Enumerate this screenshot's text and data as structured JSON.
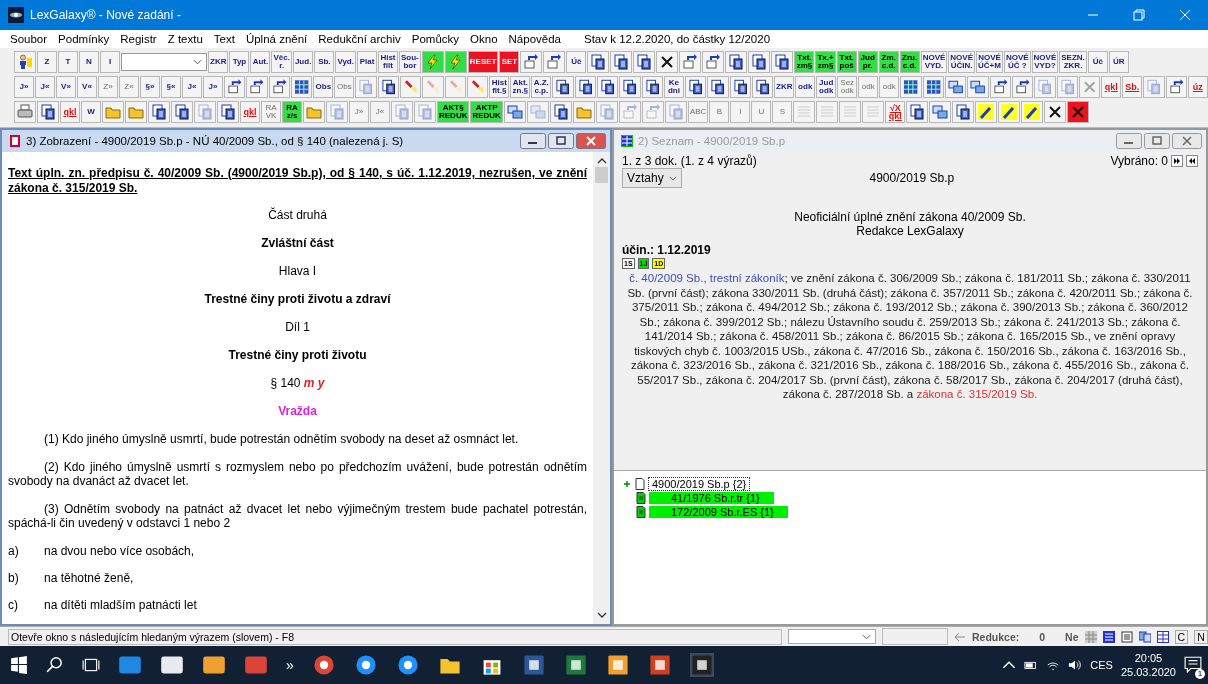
{
  "window": {
    "title": "LexGalaxy® - Nové zadání -"
  },
  "menu": {
    "items": [
      "Soubor",
      "Podmínky",
      "Registr",
      "Z textu",
      "Text",
      "Úplná znění",
      "Redukční archiv",
      "Pomůcky",
      "Okno",
      "Nápověda"
    ],
    "status": "Stav k 12.2.2020, do částky 12/2020"
  },
  "toolbar": {
    "top": [
      {
        "kind": "figure",
        "disabled": false
      },
      {
        "kind": "text",
        "label": "Z",
        "disabled": false
      },
      {
        "kind": "text",
        "label": "T",
        "disabled": false
      },
      {
        "kind": "text",
        "label": "N",
        "disabled": false
      },
      {
        "kind": "text",
        "label": "I",
        "disabled": false
      },
      {
        "kind": "combo"
      },
      {
        "kind": "text",
        "label": "ZKR",
        "disabled": false
      },
      {
        "kind": "text",
        "label": "Typ",
        "disabled": false
      },
      {
        "kind": "text",
        "label": "Aut.",
        "disabled": false
      },
      {
        "kind": "text",
        "label": "Věc.\nr.",
        "disabled": false
      },
      {
        "kind": "text",
        "label": "Jud.",
        "disabled": false
      },
      {
        "kind": "text",
        "label": "Sb.",
        "disabled": false
      },
      {
        "kind": "text",
        "label": "Vyd.",
        "disabled": false
      },
      {
        "kind": "text",
        "label": "Plat",
        "disabled": false
      },
      {
        "kind": "text",
        "label": "Hist\nfilt",
        "disabled": false
      },
      {
        "kind": "text",
        "label": "Sou-\nbor",
        "disabled": false
      },
      {
        "kind": "lightning",
        "color": "#33dd44",
        "disabled": false
      },
      {
        "kind": "lightning",
        "color": "#33dd44",
        "disabled": false
      },
      {
        "kind": "text",
        "label": "RESET",
        "color": "#ee1122",
        "disabled": false
      },
      {
        "kind": "text",
        "label": "SET",
        "color": "#ee1122",
        "disabled": false
      },
      {
        "kind": "arrow",
        "disabled": false
      },
      {
        "kind": "arrow",
        "disabled": false
      },
      {
        "kind": "text",
        "label": "Úč",
        "disabled": false
      },
      {
        "kind": "doc",
        "disabled": false
      },
      {
        "kind": "doc",
        "disabled": false
      },
      {
        "kind": "doc",
        "disabled": false
      },
      {
        "kind": "cross",
        "disabled": false
      },
      {
        "kind": "arrow",
        "disabled": false
      },
      {
        "kind": "arrow",
        "disabled": false
      },
      {
        "kind": "doc",
        "disabled": false
      },
      {
        "kind": "doc",
        "disabled": false
      },
      {
        "kind": "doc",
        "disabled": false
      },
      {
        "kind": "text",
        "label": "Txt.\nzm§",
        "color": "#33dd44",
        "disabled": false
      },
      {
        "kind": "text",
        "label": "Tx.+\nzm§",
        "color": "#33dd44",
        "disabled": false
      },
      {
        "kind": "text",
        "label": "Txt.\npoš",
        "color": "#33dd44",
        "disabled": false
      },
      {
        "kind": "text",
        "label": "Jud\npr.",
        "color": "#33dd44",
        "disabled": false
      },
      {
        "kind": "text",
        "label": "Zm.\nc.d.",
        "color": "#33dd44",
        "disabled": false
      },
      {
        "kind": "text",
        "label": "Zru.\nc.d.",
        "color": "#33dd44",
        "disabled": false
      },
      {
        "kind": "text",
        "label": "NOVÉ\nVYD.",
        "disabled": false
      },
      {
        "kind": "text",
        "label": "NOVÉ\nÚČIN.",
        "disabled": false
      },
      {
        "kind": "text",
        "label": "NOVÉ\nÚČ+M",
        "disabled": false
      },
      {
        "kind": "text",
        "label": "NOVÉ\nÚČ ?",
        "disabled": false
      },
      {
        "kind": "text",
        "label": "NOVÉ\nVYD?",
        "disabled": false
      },
      {
        "kind": "text",
        "label": "SEZN.\nZKR.",
        "disabled": false
      },
      {
        "kind": "text",
        "label": "Úč",
        "disabled": false
      },
      {
        "kind": "text",
        "label": "ÚR",
        "disabled": false
      }
    ],
    "middle": [
      {
        "kind": "text",
        "label": "J»",
        "disabled": false
      },
      {
        "kind": "text",
        "label": "J«",
        "disabled": false
      },
      {
        "kind": "text",
        "label": "V»",
        "disabled": false
      },
      {
        "kind": "text",
        "label": "V«",
        "disabled": false
      },
      {
        "kind": "text",
        "label": "Z»",
        "disabled": true
      },
      {
        "kind": "text",
        "label": "Z«",
        "disabled": true
      },
      {
        "kind": "text",
        "label": "§»",
        "disabled": false
      },
      {
        "kind": "text",
        "label": "§«",
        "disabled": false
      },
      {
        "kind": "text",
        "label": "J«",
        "disabled": false
      },
      {
        "kind": "text",
        "label": "J»",
        "disabled": false
      },
      {
        "kind": "arrow",
        "disabled": false
      },
      {
        "kind": "arrow",
        "disabled": false
      },
      {
        "kind": "arrow",
        "disabled": false
      },
      {
        "kind": "grid",
        "disabled": false
      },
      {
        "kind": "text",
        "label": "Obs",
        "disabled": false
      },
      {
        "kind": "text",
        "label": "Obs",
        "disabled": true
      },
      {
        "kind": "doc",
        "disabled": true
      },
      {
        "kind": "doc",
        "disabled": false
      },
      {
        "kind": "flashlight",
        "disabled": false
      },
      {
        "kind": "flashlight",
        "disabled": true
      },
      {
        "kind": "flashlight",
        "disabled": true
      },
      {
        "kind": "flashlight",
        "disabled": false
      },
      {
        "kind": "text",
        "label": "Hist\nflt.§",
        "disabled": false
      },
      {
        "kind": "text",
        "label": "Akt.\nzn.§",
        "disabled": false
      },
      {
        "kind": "text",
        "label": "A.Z.\nc.p.",
        "disabled": false
      },
      {
        "kind": "doc",
        "disabled": false
      },
      {
        "kind": "doc",
        "disabled": false
      },
      {
        "kind": "doc",
        "disabled": false
      },
      {
        "kind": "doc",
        "disabled": false
      },
      {
        "kind": "doc",
        "disabled": false
      },
      {
        "kind": "text",
        "label": "Ke\ndni",
        "disabled": false
      },
      {
        "kind": "doc",
        "disabled": false
      },
      {
        "kind": "doc",
        "disabled": false
      },
      {
        "kind": "doc",
        "disabled": false
      },
      {
        "kind": "doc",
        "disabled": false
      },
      {
        "kind": "text",
        "label": "ZKR",
        "disabled": false
      },
      {
        "kind": "text",
        "label": "odk",
        "disabled": false
      },
      {
        "kind": "text",
        "label": "Jud\nodk",
        "disabled": false
      },
      {
        "kind": "text",
        "label": "Sez\nodk",
        "disabled": true
      },
      {
        "kind": "text",
        "label": "odk",
        "disabled": true
      },
      {
        "kind": "text",
        "label": "odk",
        "disabled": true
      },
      {
        "kind": "grid",
        "disabled": false
      },
      {
        "kind": "grid",
        "disabled": false
      },
      {
        "kind": "windows",
        "disabled": false
      },
      {
        "kind": "windows",
        "disabled": false
      },
      {
        "kind": "arrow",
        "disabled": false
      },
      {
        "kind": "arrow",
        "disabled": false
      },
      {
        "kind": "doc",
        "disabled": true
      },
      {
        "kind": "doc",
        "disabled": true
      },
      {
        "kind": "cross",
        "disabled": true
      },
      {
        "kind": "colored-text",
        "label": "qkl",
        "color": "#e01010",
        "disabled": false
      },
      {
        "kind": "colored-text",
        "label": "Sb.",
        "color": "#e01010",
        "disabled": false
      },
      {
        "kind": "doc",
        "disabled": true
      },
      {
        "kind": "arrow",
        "disabled": false
      },
      {
        "kind": "colored-text",
        "label": "úz",
        "color": "#e01010",
        "disabled": false
      }
    ],
    "bottom": [
      {
        "kind": "printer",
        "disabled": false
      },
      {
        "kind": "doc",
        "disabled": false
      },
      {
        "kind": "colored-text",
        "label": "qkl",
        "color": "#e01010",
        "disabled": false
      },
      {
        "kind": "text",
        "label": "W",
        "disabled": false
      },
      {
        "kind": "folder",
        "disabled": false
      },
      {
        "kind": "folder",
        "disabled": false
      },
      {
        "kind": "doc",
        "disabled": false
      },
      {
        "kind": "doc",
        "disabled": false
      },
      {
        "kind": "doc",
        "disabled": true
      },
      {
        "kind": "doc",
        "disabled": false
      },
      {
        "kind": "colored-text",
        "label": "qkl",
        "color": "#e01010",
        "disabled": false
      },
      {
        "kind": "text",
        "label": "RA\nVK",
        "disabled": true
      },
      {
        "kind": "text",
        "label": "RA\nz/s",
        "color": "#33dd44",
        "disabled": false
      },
      {
        "kind": "folder",
        "disabled": false
      },
      {
        "kind": "doc",
        "disabled": true
      },
      {
        "kind": "text",
        "label": "J»",
        "disabled": true
      },
      {
        "kind": "text",
        "label": "J«",
        "disabled": true
      },
      {
        "kind": "doc",
        "disabled": true
      },
      {
        "kind": "doc",
        "disabled": true
      },
      {
        "kind": "text",
        "label": "AKT§\nREDUK",
        "color": "#33dd44",
        "disabled": false
      },
      {
        "kind": "text",
        "label": "AKTP\nREDUK",
        "color": "#33dd44",
        "disabled": false
      },
      {
        "kind": "windows",
        "disabled": false
      },
      {
        "kind": "windows",
        "disabled": true
      },
      {
        "kind": "doc",
        "disabled": false
      },
      {
        "kind": "folder",
        "disabled": false
      },
      {
        "kind": "doc",
        "disabled": true
      },
      {
        "kind": "arrow",
        "disabled": true
      },
      {
        "kind": "arrow",
        "disabled": true
      },
      {
        "kind": "doc",
        "disabled": true
      },
      {
        "kind": "text",
        "label": "ABC",
        "disabled": true
      },
      {
        "kind": "text",
        "label": "B",
        "disabled": true
      },
      {
        "kind": "text",
        "label": "I",
        "disabled": true
      },
      {
        "kind": "text",
        "label": "U",
        "disabled": true
      },
      {
        "kind": "text",
        "label": "S",
        "disabled": true
      },
      {
        "kind": "align",
        "disabled": true
      },
      {
        "kind": "align",
        "disabled": true
      },
      {
        "kind": "align",
        "disabled": true
      },
      {
        "kind": "align",
        "disabled": true
      },
      {
        "kind": "colored-text",
        "label": "√X\nqkl",
        "color": "#e01010",
        "disabled": false
      },
      {
        "kind": "doc",
        "disabled": false
      },
      {
        "kind": "windows",
        "disabled": false
      },
      {
        "kind": "doc",
        "disabled": false
      },
      {
        "kind": "wrench",
        "disabled": false
      },
      {
        "kind": "wrench",
        "disabled": false
      },
      {
        "kind": "wrench",
        "disabled": false
      },
      {
        "kind": "cross",
        "disabled": false
      },
      {
        "kind": "cross",
        "color": "#ee1122",
        "disabled": false
      }
    ]
  },
  "left_pane": {
    "title": "3) Zobrazení - 4900/2019 Sb.p - NÚ 40/2009 Sb., od § 140 (nalezená j. S)",
    "active": true,
    "blocks": [
      {
        "kind": "header",
        "text": "Text úpln. zn. předpisu č. 40/2009 Sb. (4900/2019 Sb.p), od § 140, s úč. 1.12.2019, nezrušen, ve znění zákona č. 315/2019 Sb."
      },
      {
        "kind": "center",
        "text": "Část druhá"
      },
      {
        "kind": "center-bold",
        "text": "Zvláštní část"
      },
      {
        "kind": "center",
        "text": "Hlava I"
      },
      {
        "kind": "center-bold",
        "text": "Trestné činy proti životu a zdraví"
      },
      {
        "kind": "center",
        "text": "Díl 1"
      },
      {
        "kind": "center-bold",
        "text": "Trestné činy proti životu"
      },
      {
        "kind": "section",
        "text": "§ 140",
        "marks": "m y"
      },
      {
        "kind": "title",
        "text": "Vražda"
      },
      {
        "kind": "para",
        "text": "(1) Kdo jiného úmyslně usmrtí, bude potrestán odnětím svobody na deset až osmnáct let."
      },
      {
        "kind": "para",
        "text": "(2) Kdo jiného úmyslně usmrtí s rozmyslem nebo po předchozím uvážení, bude potrestán odnětím svobody na dvanáct až dvacet let."
      },
      {
        "kind": "para",
        "text": "(3) Odnětím svobody na patnáct až dvacet let nebo výjimečným trestem bude pachatel potrestán, spáchá-li čin uvedený v odstavci 1 nebo 2"
      },
      {
        "kind": "item",
        "mark": "a)",
        "text": "na dvou nebo více osobách,"
      },
      {
        "kind": "item",
        "mark": "b)",
        "text": "na těhotné ženě,"
      },
      {
        "kind": "item",
        "mark": "c)",
        "text": "na dítěti mladším patnácti let"
      }
    ]
  },
  "right_pane": {
    "title": "2) Seznam - 4900/2019 Sb.p",
    "active": false,
    "position": "1. z 3 dok. (1. z 4 výrazů)",
    "selected_label": "Vybráno: 0",
    "relations": "Vztahy",
    "doc_id": "4900/2019 Sb.p",
    "description": [
      "Neoficiální úplné znění zákona 40/2009 Sb.",
      "Redakce LexGalaxy"
    ],
    "effective": "účin.: 1.12.2019",
    "badges": [
      {
        "label": "1S",
        "color": "#ffffff"
      },
      {
        "label": "1J",
        "color": "#00e000"
      },
      {
        "label": "1D",
        "color": "#ffff00"
      }
    ],
    "amendments": [
      {
        "text": "č. 40/2009 Sb., trestní zákoník",
        "color": "#3a4fc0"
      },
      {
        "text": "; ve znění zákona č. 306/2009 Sb.; zákona č. 181/2011 Sb.; zákona č. 330/2011 Sb. (první část); zákona 330/2011 Sb. (druhá část); zákona č. 357/2011 Sb.; zákona č. 420/2011 Sb.; zákona č. 375/2011 Sb.; zákona č. 494/2012 Sb.; zákona č. 193/2012 Sb.; zákona č. 390/2013 Sb.; zákona č. 360/2012 Sb.; zákona č. 399/2012 Sb.; nálezu Ústavního soudu č. 259/2013 Sb.; zákona č. 241/2013 Sb.; zákona č. 141/2014 Sb.; zákona č. 458/2011 Sb.; zákona č. 86/2015 Sb.; zákona č. 165/2015 Sb., ve znění opravy tiskových chyb č. 1003/2015 USb., zákona č. 47/2016 Sb., zákona č. 150/2016 Sb., zákona č. 163/2016 Sb., zákona č. 323/2016 Sb., zákona č. 321/2016 Sb., zákona č. 188/2016 Sb., zákona č. 455/2016 Sb., zákona č. 55/2017 Sb., zákona č. 204/2017 Sb. (první část), zákona č. 58/2017 Sb., zákona č. 204/2017 (druhá část), zákona č. 287/2018 Sb. a ",
        "color": "#1a1a1a"
      },
      {
        "text": "zákona č. 315/2019 Sb.",
        "color": "#e03030"
      }
    ],
    "tree": [
      {
        "label": "4900/2019 Sb.p {2}",
        "expanded": false,
        "marked": false,
        "children": [
          {
            "label": "41/1976 Sb.r.tr {1}",
            "marked": true
          },
          {
            "label": "172/2009 Sb.r.ES {1}",
            "marked": true
          }
        ]
      }
    ]
  },
  "status_bar": {
    "hint": "Otevře okno s následujícím hledaným výrazem (slovem) - F8",
    "reduction_label": "Redukce:",
    "reduction_value": "0",
    "flag": "Ne",
    "letters": [
      "C",
      "N"
    ]
  },
  "taskbar": {
    "more": "»",
    "language": "CES",
    "time": "20:05",
    "date": "25.03.2020",
    "notifications": "1"
  }
}
